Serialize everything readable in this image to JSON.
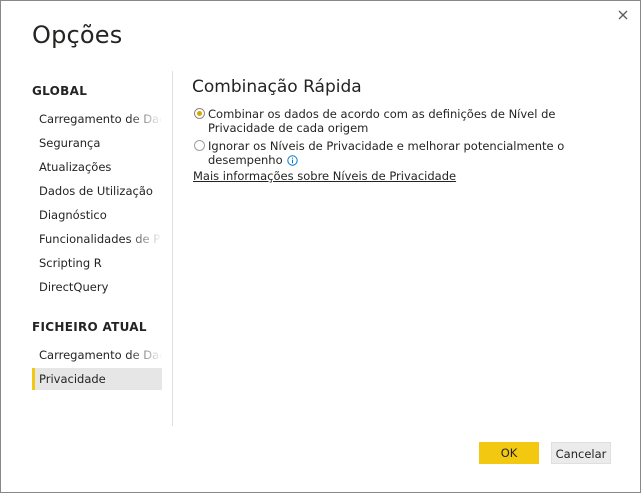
{
  "dialog": {
    "title": "Opções",
    "close_icon": "close-icon"
  },
  "sidebar": {
    "global_title": "GLOBAL",
    "global_items": [
      {
        "label": "Carregamento de Dados"
      },
      {
        "label": "Segurança"
      },
      {
        "label": "Atualizações"
      },
      {
        "label": "Dados de Utilização"
      },
      {
        "label": "Diagnóstico"
      },
      {
        "label": "Funcionalidades de Pré-v"
      },
      {
        "label": "Scripting R"
      },
      {
        "label": "DirectQuery"
      }
    ],
    "current_title": "FICHEIRO ATUAL",
    "current_items": [
      {
        "label": "Carregamento de Dados"
      },
      {
        "label": "Privacidade",
        "selected": true
      }
    ]
  },
  "main": {
    "title": "Combinação Rápida",
    "options": [
      {
        "label": "Combinar os dados de acordo com as definições de Nível de Privacidade de cada origem",
        "checked": true
      },
      {
        "label": "Ignorar os Níveis de Privacidade e melhorar potencialmente o desempenho",
        "checked": false,
        "icon": "info-icon"
      }
    ],
    "link": "Mais informações sobre Níveis de Privacidade"
  },
  "footer": {
    "ok_label": "OK",
    "cancel_label": "Cancelar"
  },
  "colors": {
    "accent": "#f2c811",
    "selected_bg": "#e6e6e6",
    "info_blue": "#0078d4"
  }
}
